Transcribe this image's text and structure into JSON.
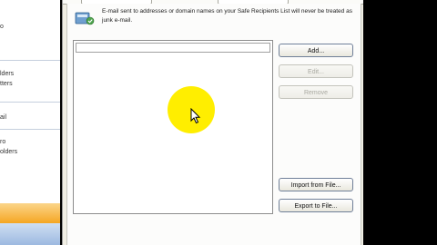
{
  "left_nav": {
    "fragments": [
      "o",
      "lders",
      "tters",
      "ail",
      "ro",
      "olders"
    ]
  },
  "dialog": {
    "info_text": "E-mail sent to addresses or domain names on your Safe Recipients List will never be treated as junk e-mail.",
    "buttons": {
      "add": "Add...",
      "edit": "Edit...",
      "remove": "Remove",
      "import": "Import from File...",
      "export": "Export to File..."
    }
  },
  "colors": {
    "highlight": "#ffee00",
    "dialog_bg": "#f0eee4",
    "nav_orange": "#f5a623",
    "nav_blue": "#9db9e0"
  },
  "icons": {
    "info": "address-list-icon",
    "cursor": "mouse-pointer-icon"
  }
}
